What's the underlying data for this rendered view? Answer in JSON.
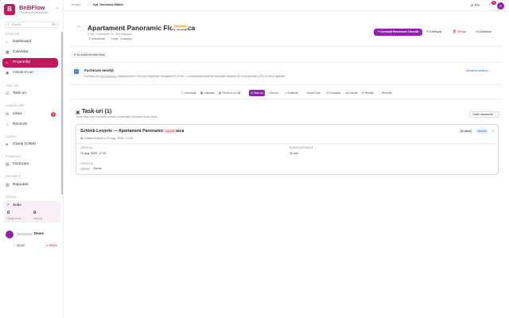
{
  "app": {
    "name": "BnBFlow",
    "tagline": "Gestionare simplificata",
    "logo_letter": "B"
  },
  "sidebar": {
    "search_placeholder": "Caută...",
    "search_shortcut": "⌘K",
    "sections": {
      "principal": "Principal",
      "task": "Task-uri",
      "comunicare": "Comunicare",
      "clienti": "Clienți",
      "financiar": "Financiar",
      "rapoarte": "Rapoarte",
      "sistem": "Sistem"
    },
    "items": [
      {
        "label": "Dashboard",
        "icon": "⌂"
      },
      {
        "label": "Calendar",
        "icon": "▦"
      },
      {
        "label": "Proprietăți",
        "icon": "⌂"
      },
      {
        "label": "Check-in-uri",
        "icon": "◉"
      },
      {
        "label": "Task-uri",
        "icon": "☑"
      },
      {
        "label": "Inbox",
        "icon": "✉",
        "badge": "8"
      },
      {
        "label": "Recenzii",
        "icon": "☆"
      },
      {
        "label": "Clienți (CRM)",
        "icon": "👤"
      },
      {
        "label": "Facturare",
        "icon": "▤"
      },
      {
        "label": "Rapoarte",
        "icon": "▥"
      }
    ],
    "activity": {
      "title": "Activ",
      "v1": "0",
      "l1": "Check-in-uri",
      "v2": "0",
      "l2": "Task-uri"
    },
    "user": {
      "name": "Demo"
    },
    "help": "Ajutor",
    "logout": "Ieșire"
  },
  "topbar": {
    "crumb1": "Acasă",
    "crumb2": "›",
    "crumb3": "Apt. floreasca-5f8d2c",
    "lang": "RO",
    "notif_count": "3",
    "avatar": "A"
  },
  "property": {
    "title": "Apartament Panoramic Floreasca",
    "status": "Disponibil",
    "address": "Str. Floreasca 71, Cluj-Napoca",
    "meta": [
      "2 dormitoare",
      "1 baie",
      "4 oaspeți"
    ]
  },
  "actions": {
    "primary": "Creează Rezervare Directă",
    "edit": "Editează",
    "delete": "Șterge",
    "share": "Distribuie"
  },
  "chip": "Nu există checklist setup",
  "banner": {
    "title": "Facturare neseță",
    "desc_prefix": "Contract cu",
    "desc": "Apartamentul e al unui proprietar înregistrat în CRM — completați proprietar facturare separat de la proprietari (2,5) nu de la agenție.",
    "link": "Modifică setările ›"
  },
  "tabs": [
    {
      "label": "Informații",
      "icon": "ⓘ"
    },
    {
      "label": "Calendar",
      "icon": "▦"
    },
    {
      "label": "Check-in-uri",
      "icon": "◉",
      "count": "14"
    },
    {
      "label": "Task-uri",
      "icon": "☑",
      "active": true
    },
    {
      "label": "Live-uri",
      "icon": "⌁"
    },
    {
      "label": "Notificări",
      "icon": "♫"
    },
    {
      "label": "Smart Lock",
      "icon": "⌂"
    },
    {
      "label": "Proprietar",
      "icon": "⚲"
    },
    {
      "label": "Canale",
      "icon": "⇄"
    },
    {
      "label": "Mesaje",
      "icon": "✉"
    },
    {
      "label": "Recenzii",
      "icon": "☆"
    }
  ],
  "tasks": {
    "title": "Task-uri (1)",
    "desc": "Toate task-urile asociate acestei proprietăți (împărțite după stare)",
    "filter": "Toate statusurile",
    "items": [
      {
        "title": "Schimb Lenjerie — Apartament Panoramic Floreasca",
        "badge": "Urgente",
        "type": "Schimb lenjerie",
        "date": "21 aug. 2025 • 11:00",
        "status": "De alocat",
        "priority": "Normal",
        "created_label": "Creat la",
        "created_val": "19 aug. 2025, 17:30",
        "duration_label": "Durată estimată",
        "duration_val": "30 min",
        "by_label": "Creat de",
        "by_val": "Demo"
      }
    ]
  }
}
